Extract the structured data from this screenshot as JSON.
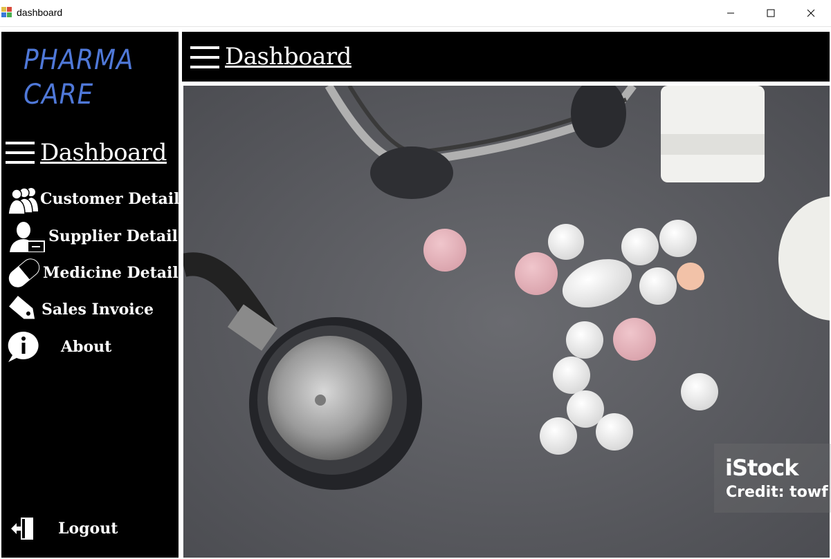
{
  "window": {
    "title": "dashboard",
    "minimize_icon": "minimize-icon",
    "maximize_icon": "maximize-icon",
    "close_icon": "close-icon"
  },
  "sidebar": {
    "logo_line1": "PHARMA",
    "logo_line2": "CARE",
    "logo_color": "#4f78d8",
    "dashboard_label": "Dashboard",
    "items": [
      {
        "label": "Customer Detail",
        "icon": "users-icon"
      },
      {
        "label": "Supplier Detail",
        "icon": "supplier-icon"
      },
      {
        "label": "Medicine Detail",
        "icon": "pill-icon"
      },
      {
        "label": "Sales Invoice",
        "icon": "tag-icon"
      },
      {
        "label": "About",
        "icon": "info-icon"
      }
    ],
    "logout_label": "Logout"
  },
  "header": {
    "title": "Dashboard",
    "menu_icon": "hamburger-icon"
  },
  "photo": {
    "watermark": "iStock",
    "credit": "Credit: towf"
  },
  "colors": {
    "sidebar_bg": "#000000",
    "text": "#ffffff",
    "photo_bg": "#5d5e62"
  }
}
